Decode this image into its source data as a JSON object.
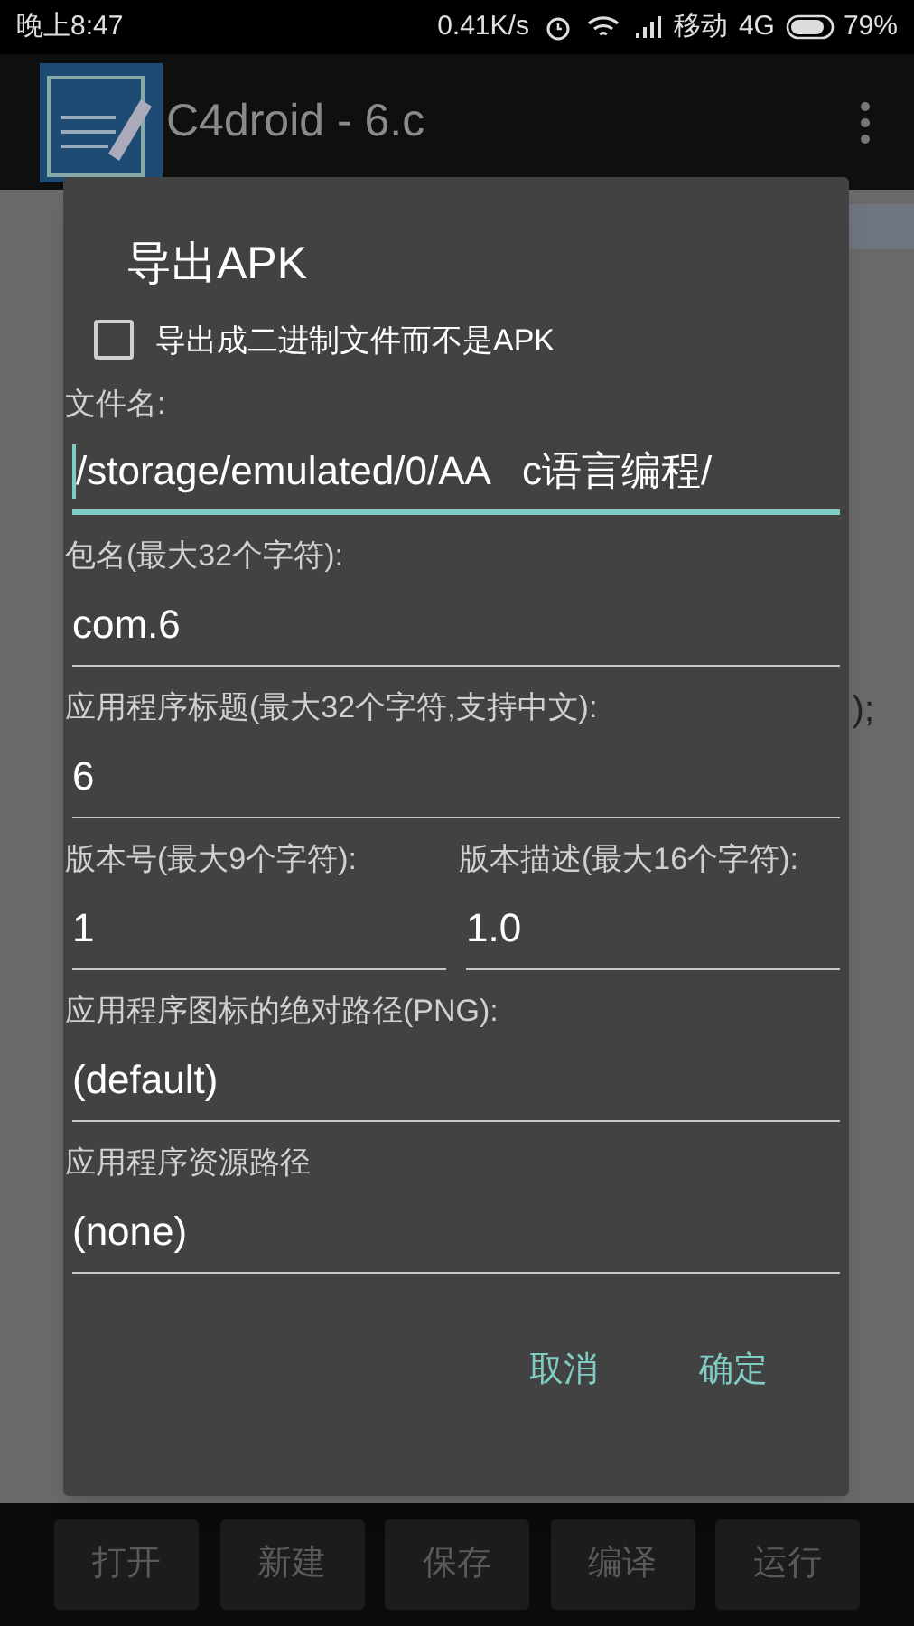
{
  "status_bar": {
    "time": "晚上8:47",
    "speed": "0.41K/s",
    "carrier": "移动",
    "network": "4G",
    "battery": "79%"
  },
  "app_bar": {
    "title": "C4droid - 6.c"
  },
  "editor_fragment": ");",
  "dialog": {
    "title": "导出APK",
    "binary_option": {
      "label": "导出成二进制文件而不是APK",
      "checked": false
    },
    "field_rows": [
      [
        {
          "label": "文件名:",
          "value": "/storage/emulated/0/AA   c语言编程/",
          "focused": true
        }
      ],
      [
        {
          "label": "包名(最大32个字符):",
          "value": "com.6",
          "focused": false
        }
      ],
      [
        {
          "label": "应用程序标题(最大32个字符,支持中文):",
          "value": "6",
          "focused": false
        }
      ],
      [
        {
          "label": "版本号(最大9个字符):",
          "value": "1",
          "focused": false
        },
        {
          "label": "版本描述(最大16个字符):",
          "value": "1.0",
          "focused": false
        }
      ],
      [
        {
          "label": "应用程序图标的绝对路径(PNG):",
          "value": "(default)",
          "focused": false
        }
      ],
      [
        {
          "label": "应用程序资源路径",
          "value": "(none)",
          "focused": false
        }
      ]
    ],
    "buttons": [
      "取消",
      "确定"
    ]
  },
  "toolbar": [
    "打开",
    "新建",
    "保存",
    "编译",
    "运行"
  ]
}
